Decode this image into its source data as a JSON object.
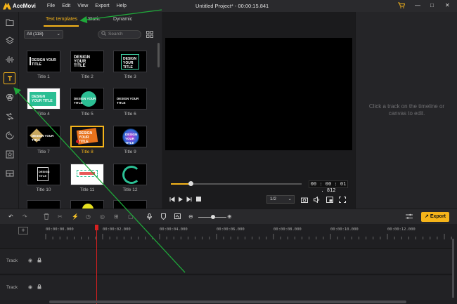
{
  "app": {
    "name": "AceMovi",
    "window_title": "Untitled Project* - 00:00:15.841",
    "menu": [
      "File",
      "Edit",
      "View",
      "Export",
      "Help"
    ],
    "window_controls": {
      "minimize": "—",
      "maximize": "□",
      "close": "✕"
    }
  },
  "colors": {
    "accent": "#f5b41a",
    "annotation": "#1fa83a",
    "playhead": "#d62020"
  },
  "sidebar": {
    "items": [
      {
        "name": "media-icon"
      },
      {
        "name": "layers-icon"
      },
      {
        "name": "audio-icon"
      },
      {
        "name": "text-icon",
        "active": true
      },
      {
        "name": "filters-icon"
      },
      {
        "name": "transitions-icon"
      },
      {
        "name": "stickers-icon"
      },
      {
        "name": "effects-icon"
      },
      {
        "name": "templates-icon"
      }
    ]
  },
  "text_panel": {
    "tabs": [
      "Text templates",
      "Static",
      "Dynamic"
    ],
    "active_tab": "Text templates",
    "filter": "All (118)",
    "search_placeholder": "Search",
    "items": [
      {
        "label": "Title 1",
        "text": "DESIGN YOUR TITLE"
      },
      {
        "label": "Title 2",
        "text": "DESIGN YOUR TITLE"
      },
      {
        "label": "Title 3",
        "text": "DESIGN YOUR TITLE"
      },
      {
        "label": "Title 4",
        "text": "DESIGN YOUR TITLE"
      },
      {
        "label": "Title 5",
        "text": "DESIGN YOUR TITLE"
      },
      {
        "label": "Title 6",
        "text": "DESIGN YOUR TITLE"
      },
      {
        "label": "Title 7",
        "text": "DESIGN YOUR TITLE"
      },
      {
        "label": "Title 8",
        "text": "DESIGN YOUR TITLE",
        "selected": true
      },
      {
        "label": "Title 9",
        "text": "DESIGN YOUR TITLE"
      },
      {
        "label": "Title 10",
        "text": "DESIGN TITLE"
      },
      {
        "label": "Title 11",
        "text": ""
      },
      {
        "label": "Title 12",
        "text": ""
      }
    ]
  },
  "player": {
    "timecode": "00 : 00 : 01 . 812",
    "progress": 0.15,
    "ratio": "1/2"
  },
  "properties": {
    "hint": "Click a track on the timeline or canvas to edit."
  },
  "toolbar": {
    "export_label": "Export"
  },
  "timeline": {
    "ticks": [
      "00:00:00.000",
      "00:00:02.000",
      "00:00:04.000",
      "00:00:06.000",
      "00:00:08.000",
      "00:00:10.000",
      "00:00:12.000"
    ],
    "add_track": "+",
    "tracks": [
      {
        "label": "Track"
      },
      {
        "label": "Track"
      }
    ]
  }
}
